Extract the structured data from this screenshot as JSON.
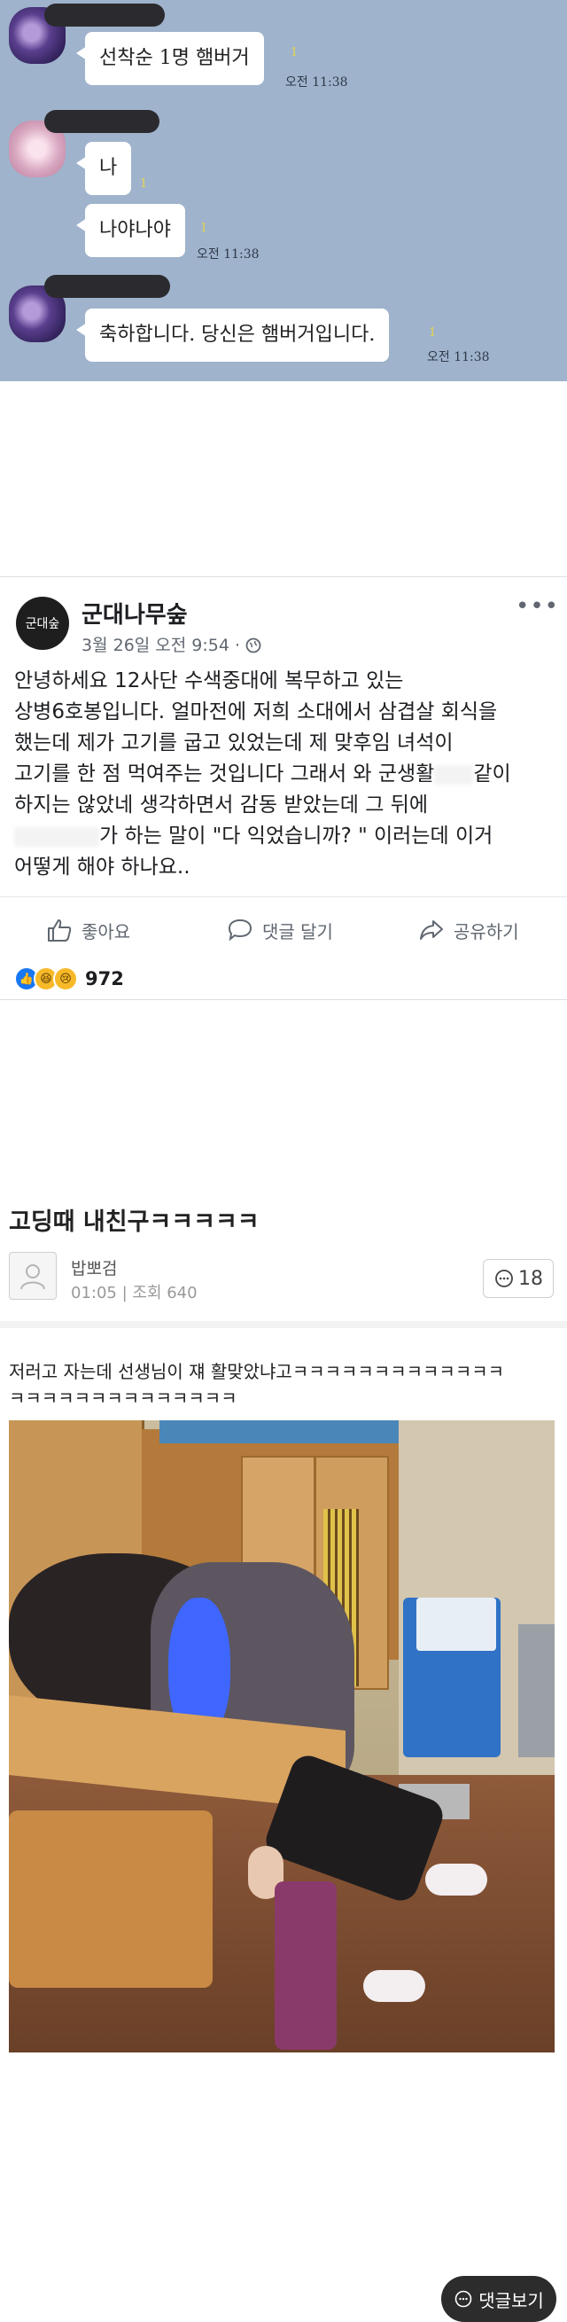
{
  "chat": {
    "messages": [
      {
        "text": "선착순 1명 햄버거",
        "unread": "1",
        "time": "오전 11:38"
      },
      {
        "text": "나",
        "unread": "1"
      },
      {
        "text": "나야나야",
        "unread": "1",
        "time": "오전 11:38"
      },
      {
        "text": "축하합니다. 당신은 햄버거입니다.",
        "unread": "1",
        "time": "오전 11:38"
      }
    ]
  },
  "facebook": {
    "page_avatar_text": "군대숲",
    "page_name": "군대나무숲",
    "meta": "3월 26일 오전 9:54 · ",
    "body_lines": [
      "안녕하세요 12사단 수색중대에 복무하고 있는",
      "상병6호봉입니다. 얼마전에 저희 소대에서 삼겹살 회식을",
      "했는데 제가 고기를 굽고 있었는데 제 맞후임 녀석이",
      "고기를 한 점 먹여주는 것입니다 그래서 와 군생활",
      "같이",
      "하지는 않았네 생각하면서 감동 받았는데 그 뒤에",
      "가 하는 말이 \"다 익었습니까? \" 이러는데 이거",
      "어떻게 해야 하나요.."
    ],
    "actions": {
      "like": "좋아요",
      "comment": "댓글 달기",
      "share": "공유하기"
    },
    "reaction_count": "972",
    "colors": {
      "like_blue": "#1877f2",
      "emoji_yellow": "#f7b928"
    }
  },
  "forum": {
    "title": "고딩때 내친구ㅋㅋㅋㅋㅋ",
    "author": "밥뽀검",
    "meta": "01:05 | 조회 640",
    "comment_count": "18",
    "body_lines": [
      "저러고 자는데 선생님이 쟤 활맞았냐고ㅋㅋㅋㅋㅋㅋㅋㅋㅋㅋㅋㅋㅋ",
      "ㅋㅋㅋㅋㅋㅋㅋㅋㅋㅋㅋㅋㅋㅋ"
    ],
    "view_comments_label": "댓글보기"
  }
}
